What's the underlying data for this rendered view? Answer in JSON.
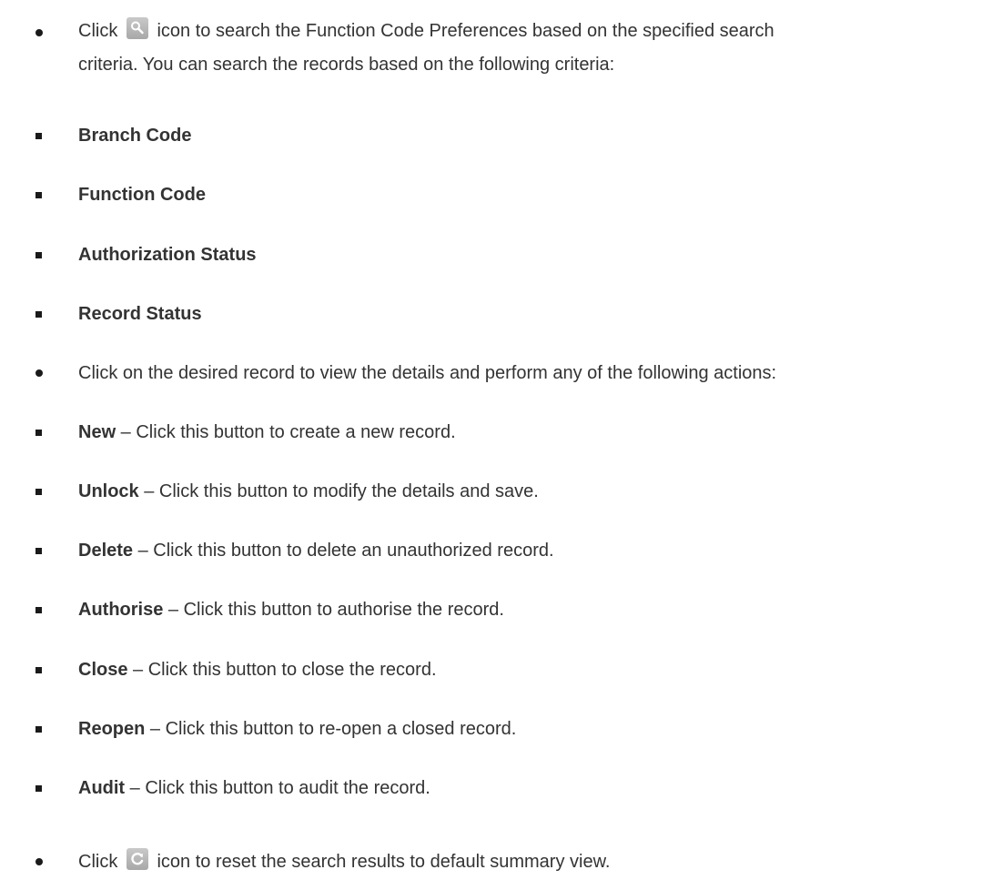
{
  "intro": {
    "line1_before": "Click",
    "line1_after": "icon to search the Function Code Preferences based on the specified search",
    "line2": "criteria. You can search the records based on the following criteria:",
    "search_icon": "search-icon"
  },
  "criteria": [
    "Branch Code",
    "Function Code",
    "Authorization Status",
    "Record Status"
  ],
  "record_intro": "Click on the desired record to view the details and perform any of the following actions:",
  "actions": [
    {
      "name": "New",
      "desc": " – Click this button to create a new record."
    },
    {
      "name": "Unlock",
      "desc": " – Click this button to modify the details and save."
    },
    {
      "name": "Delete",
      "desc": " – Click this button to delete an unauthorized record."
    },
    {
      "name": "Authorise",
      "desc": " – Click this button to authorise the record."
    },
    {
      "name": "Close",
      "desc": " – Click this button to close the record."
    },
    {
      "name": "Reopen",
      "desc": " – Click this button to re-open a closed record."
    },
    {
      "name": "Audit",
      "desc": " – Click this button to audit the record."
    }
  ],
  "reset": {
    "before": "Click",
    "after": "icon to reset the search results to default summary view.",
    "reset_icon": "refresh-icon"
  }
}
